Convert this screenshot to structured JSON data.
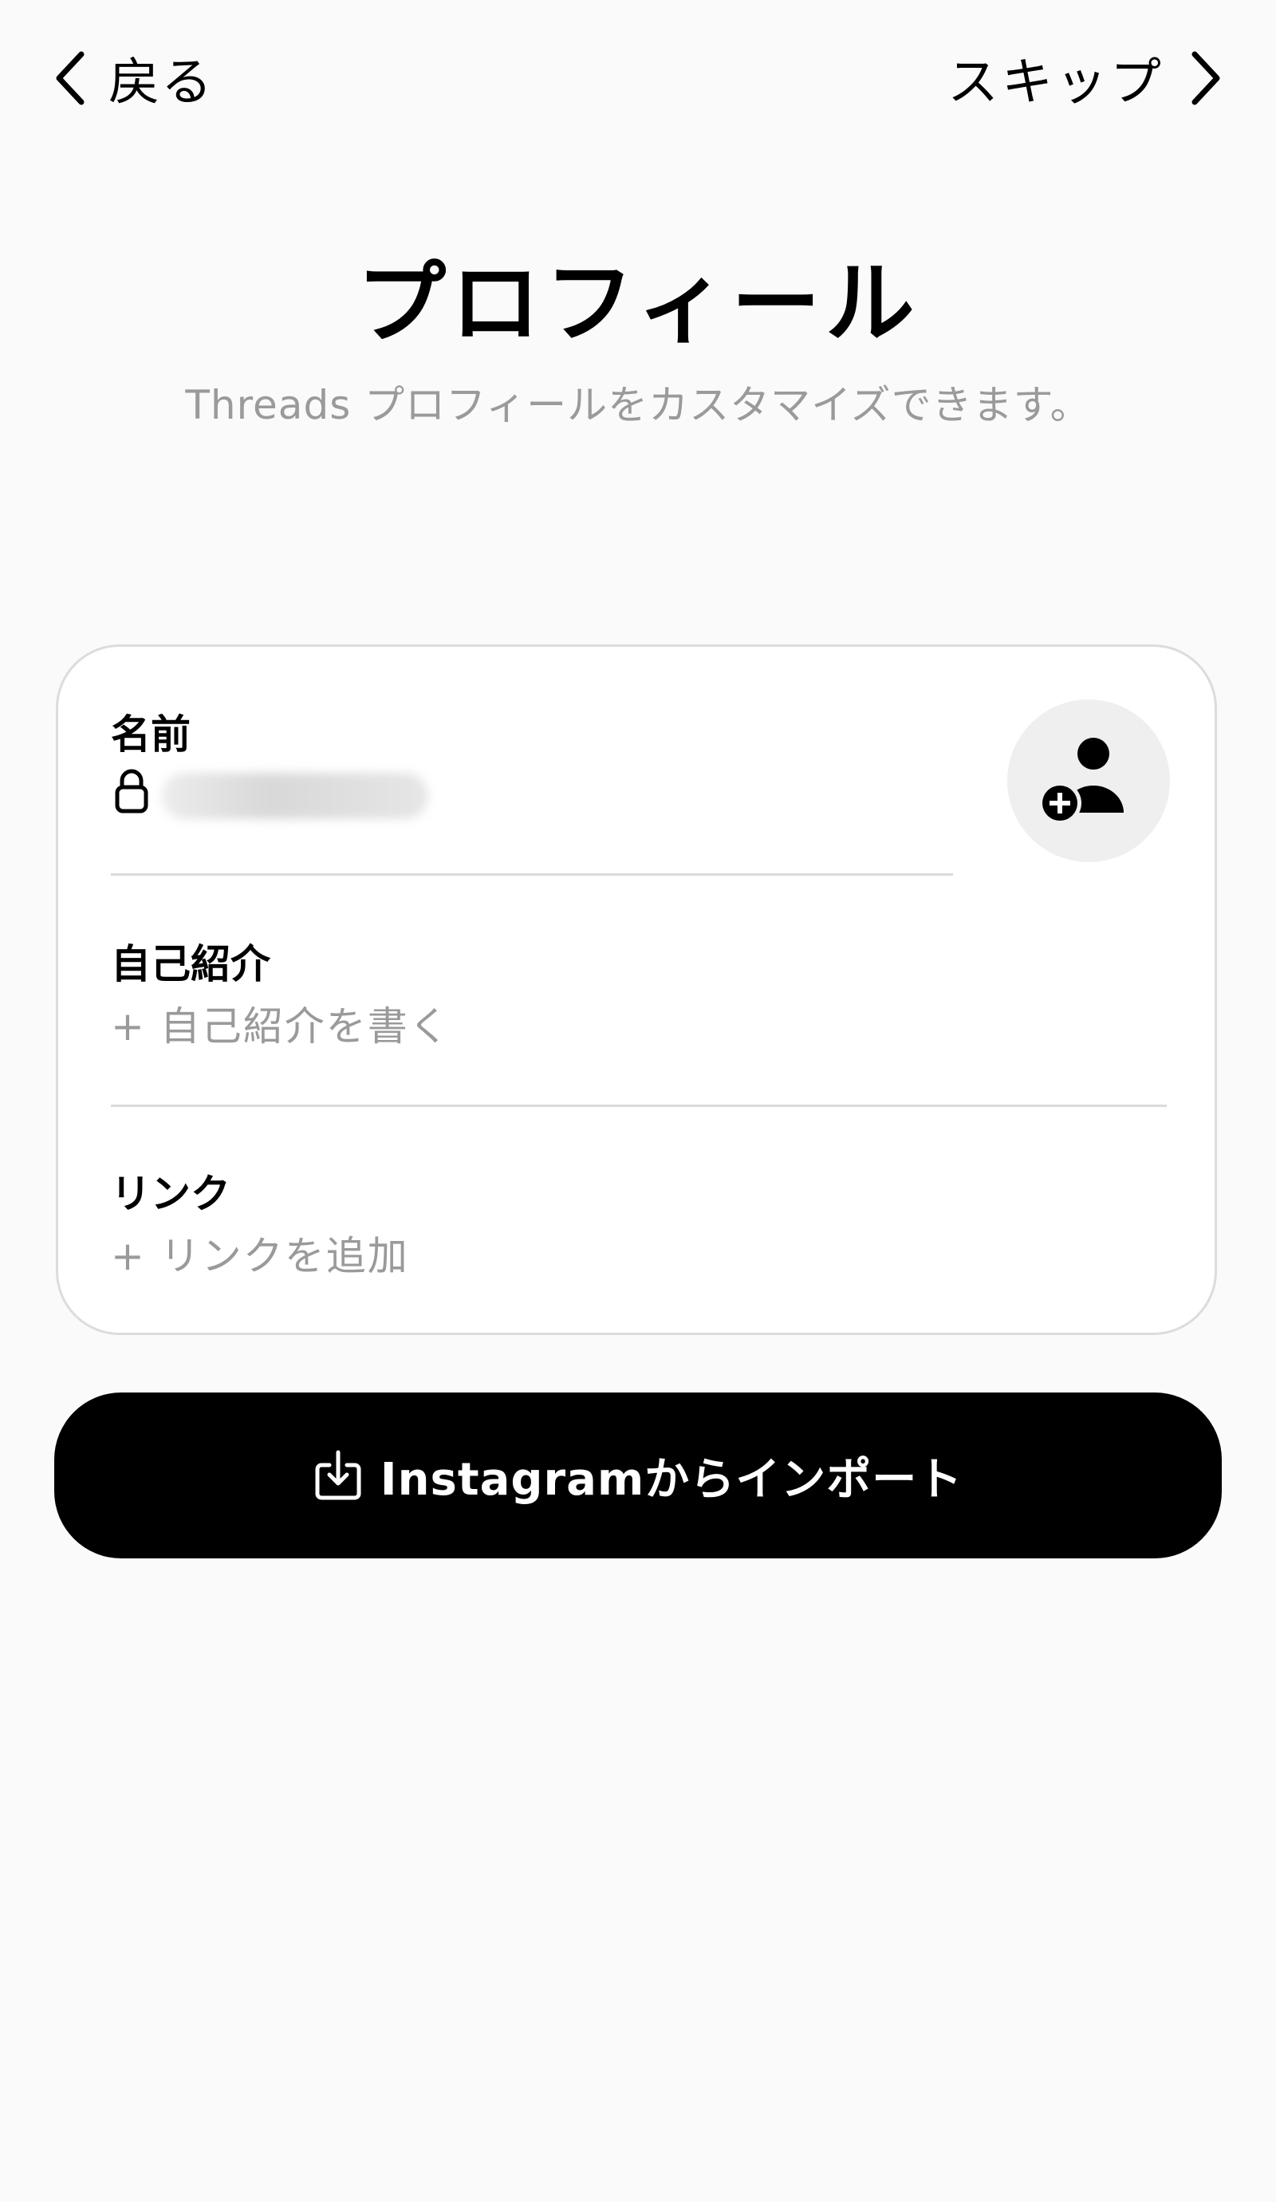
{
  "nav": {
    "back_label": "戻る",
    "skip_label": "スキップ"
  },
  "header": {
    "title": "プロフィール",
    "subtitle": "Threads プロフィールをカスタマイズできます。"
  },
  "profile_form": {
    "name": {
      "label": "名前"
    },
    "bio": {
      "label": "自己紹介",
      "placeholder": "+ 自己紹介を書く"
    },
    "link": {
      "label": "リンク",
      "placeholder": "+ リンクを追加"
    }
  },
  "import_button": {
    "label": "Instagramからインポート"
  },
  "colors": {
    "background": "#fafafa",
    "card": "#ffffff",
    "card_border": "#dcdcdc",
    "muted_text": "#9a9a9a",
    "button": "#000000",
    "button_text": "#ffffff",
    "avatar_bg": "#efefef"
  },
  "icons": {
    "back": "chevron-left-icon",
    "skip": "chevron-right-icon",
    "lock": "lock-icon",
    "avatar": "add-person-icon",
    "import": "import-download-icon"
  }
}
